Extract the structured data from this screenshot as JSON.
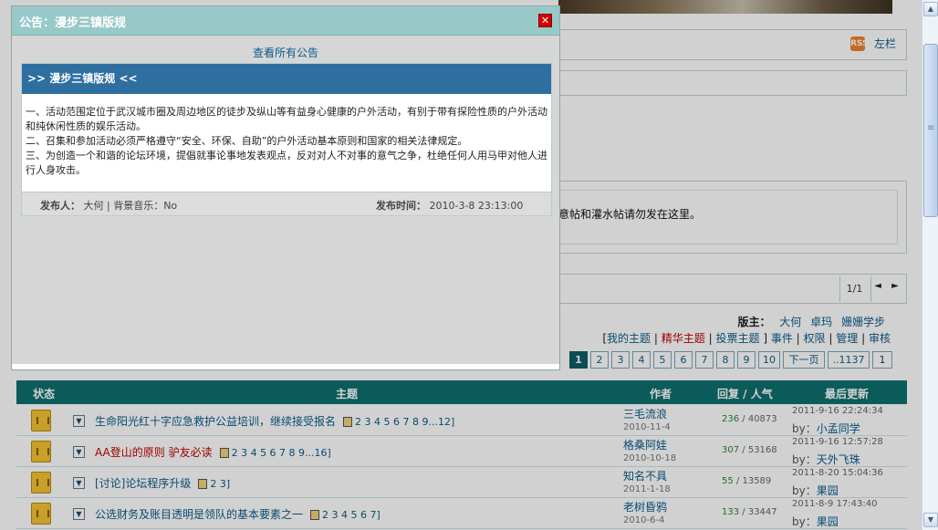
{
  "modal": {
    "title": "公告：漫步三镇版规",
    "close_label": "✕",
    "view_all": "查看所有公告",
    "notice_title": ">> 漫步三镇版规 <<",
    "body_lines": [
      "一、活动范围定位于武汉城市圈及周边地区的徒步及纵山等有益身心健康的户外活动，有别于带有探险性质的户外活动和纯休闲性质的娱乐活动。",
      "二、召集和参加活动必须严格遵守“安全、环保、自助”的户外活动基本原则和国家的相关法律规定。",
      "三、为创造一个和谐的论坛环境，提倡就事论事地发表观点，反对对人不对事的意气之争，杜绝任何人用马甲对他人进行人身攻击。"
    ],
    "footer_publisher_label": "发布人：",
    "footer_publisher": "大何 | 背景音乐：No",
    "footer_time_label": "发布时间：",
    "footer_time": "2010-3-8 23:13:00"
  },
  "page": {
    "left_col_link": "左栏",
    "rss_label": "RSS",
    "notice_text": "意帖和灌水帖请勿发在这里。",
    "pager_count": "1/1",
    "pager_arrows": "◄ ►",
    "moderators_label": "版主：",
    "moderators": [
      "大何",
      "卓玛",
      "姗姗学步"
    ],
    "toolbar": {
      "open": "[",
      "my_topics": "我的主题",
      "featured": "精华主题",
      "poll": "投票主题",
      "events": "事件",
      "permissions": "权限",
      "manage": "管理",
      "review": "审核",
      "sep": "|",
      "close": "]"
    },
    "page_numbers": [
      "1",
      "2",
      "3",
      "4",
      "5",
      "6",
      "7",
      "8",
      "9",
      "10"
    ],
    "next_page": "下一页",
    "last_page": "..1137",
    "page_input": "1",
    "table_headers": {
      "status": "状态",
      "topic": "主题",
      "author": "作者",
      "replies": "回复 / 人气",
      "last_update": "最后更新"
    },
    "rows": [
      {
        "title": "生命阳光红十字应急救护公益培训，继续接受报名",
        "pages": "2 3 4 5 6 7 8 9...12]",
        "author": "三毛流浪",
        "date": "2010-11-4",
        "replies": "236",
        "views": "40873",
        "last_time": "2011-9-16 22:24:34",
        "last_by": "小孟同学"
      },
      {
        "title": "AA登山的原则  驴友必读",
        "pages": "2 3 4 5 6 7 8 9...16]",
        "author": "格桑阿娃",
        "date": "2010-10-18",
        "replies": "307",
        "views": "53168",
        "last_time": "2011-9-16 12:57:28",
        "last_by": "天外飞珠"
      },
      {
        "title": "[讨论]论坛程序升级",
        "pages": "2 3]",
        "author": "知名不具",
        "date": "2011-1-18",
        "replies": "55",
        "views": "13589",
        "last_time": "2011-8-20 15:04:36",
        "last_by": "果园"
      },
      {
        "title": "公选财务及账目透明是领队的基本要素之一",
        "pages": "2 3 4 5 6 7]",
        "author": "老树昏鸦",
        "date": "2010-6-4",
        "replies": "133",
        "views": "33447",
        "last_time": "2011-8-9 17:43:40",
        "last_by": "果园"
      }
    ],
    "by_label": "by：",
    "slash": " / "
  },
  "colors": {
    "modal_header": "#98c9c9",
    "notice_bar": "#2e6fa0",
    "table_header": "#0e6f6f",
    "close_button": "#d40000"
  }
}
